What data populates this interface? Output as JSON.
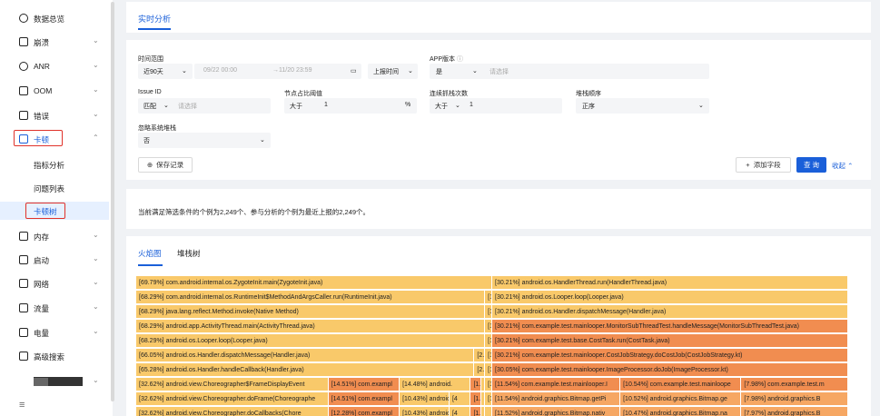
{
  "sidebar": {
    "items": [
      {
        "label": "数据总览",
        "icon": "clock-icon",
        "has_chevron": false
      },
      {
        "label": "崩溃",
        "icon": "crash-icon",
        "has_chevron": true
      },
      {
        "label": "ANR",
        "icon": "anr-icon",
        "has_chevron": true
      },
      {
        "label": "OOM",
        "icon": "oom-icon",
        "has_chevron": true
      },
      {
        "label": "错误",
        "icon": "error-icon",
        "has_chevron": true
      },
      {
        "label": "卡顿",
        "icon": "lag-icon",
        "has_chevron": true,
        "expanded": true
      },
      {
        "label": "内存",
        "icon": "memory-icon",
        "has_chevron": true
      },
      {
        "label": "启动",
        "icon": "startup-icon",
        "has_chevron": true
      },
      {
        "label": "网络",
        "icon": "network-icon",
        "has_chevron": true
      },
      {
        "label": "流量",
        "icon": "traffic-icon",
        "has_chevron": true
      },
      {
        "label": "电量",
        "icon": "battery-icon",
        "has_chevron": true
      },
      {
        "label": "高级搜索",
        "icon": "search-icon",
        "has_chevron": false
      }
    ],
    "sub_items": [
      {
        "label": "指标分析"
      },
      {
        "label": "问题列表"
      },
      {
        "label": "卡顿树",
        "active": true
      }
    ]
  },
  "header": {
    "tab": "实时分析"
  },
  "filters": {
    "time_range": {
      "label": "时间范围",
      "preset": "近90天",
      "start": "09/22 00:00",
      "end": "→11/20 23:59",
      "mode": "上报时间"
    },
    "app_version": {
      "label": "APP版本",
      "op": "是",
      "placeholder": "请选择"
    },
    "issue_id": {
      "label": "Issue ID",
      "op": "匹配",
      "placeholder": "请选择"
    },
    "node_ratio": {
      "label": "节点占比阈值",
      "op": "大于",
      "value": "1",
      "unit": "%"
    },
    "consecutive": {
      "label": "连续抓栈次数",
      "op": "大于",
      "value": "1"
    },
    "stack_order": {
      "label": "堆栈顺序",
      "value": "正序"
    },
    "ignore_system": {
      "label": "忽略系统堆栈",
      "value": "否"
    }
  },
  "actions": {
    "save": "保存记录",
    "add_field": "添加字段",
    "query": "查 询",
    "collapse": "收起"
  },
  "summary": "当前满足筛选条件的个例为2,249个、参与分析的个例为最近上报的2,249个。",
  "flame_tabs": [
    {
      "label": "火焰图",
      "active": true
    },
    {
      "label": "堆栈树",
      "active": false
    }
  ],
  "colors": {
    "accent": "#1a5fd9",
    "flame_light": "#f9c96a",
    "flame_mid": "#f6a763",
    "flame_dark": "#f18d50"
  },
  "flame": {
    "rows": [
      [
        {
          "l": "[69.79%] com.android.internal.os.ZygoteInit.main(ZygoteInit.java)",
          "s": 0,
          "w": 0.5,
          "c": "l"
        },
        {
          "l": "[30.21%] android.os.HandlerThread.run(HandlerThread.java)",
          "s": 0.5,
          "w": 0.5,
          "c": "l"
        }
      ],
      [
        {
          "l": "[68.29%] com.android.internal.os.RuntimeInit$MethodAndArgsCaller.run(RuntimeInit.java)",
          "s": 0,
          "w": 0.49,
          "c": "l"
        },
        {
          "l": "[1",
          "s": 0.49,
          "w": 0.01,
          "c": "l"
        },
        {
          "l": "[30.21%] android.os.Looper.loop(Looper.java)",
          "s": 0.5,
          "w": 0.5,
          "c": "l"
        }
      ],
      [
        {
          "l": "[68.29%] java.lang.reflect.Method.invoke(Native Method)",
          "s": 0,
          "w": 0.49,
          "c": "l"
        },
        {
          "l": "[1",
          "s": 0.49,
          "w": 0.01,
          "c": "l"
        },
        {
          "l": "[30.21%] android.os.Handler.dispatchMessage(Handler.java)",
          "s": 0.5,
          "w": 0.5,
          "c": "l"
        }
      ],
      [
        {
          "l": "[68.29%] android.app.ActivityThread.main(ActivityThread.java)",
          "s": 0,
          "w": 0.49,
          "c": "l"
        },
        {
          "l": "[1",
          "s": 0.49,
          "w": 0.01,
          "c": "l"
        },
        {
          "l": "[30.21%] com.example.test.mainlooper.MonitorSubThreadTest.handleMessage(MonitorSubThreadTest.java)",
          "s": 0.5,
          "w": 0.5,
          "c": "d"
        }
      ],
      [
        {
          "l": "[68.29%] android.os.Looper.loop(Looper.java)",
          "s": 0,
          "w": 0.49,
          "c": "l"
        },
        {
          "l": "[1",
          "s": 0.49,
          "w": 0.01,
          "c": "l"
        },
        {
          "l": "[30.21%] com.example.test.base.CostTask.run(CostTask.java)",
          "s": 0.5,
          "w": 0.5,
          "c": "d"
        }
      ],
      [
        {
          "l": "[66.05%] android.os.Handler.dispatchMessage(Handler.java)",
          "s": 0,
          "w": 0.475,
          "c": "l"
        },
        {
          "l": "[2.",
          "s": 0.475,
          "w": 0.015,
          "c": "l"
        },
        {
          "l": "[1",
          "s": 0.49,
          "w": 0.01,
          "c": "l"
        },
        {
          "l": "[30.21%] com.example.test.mainlooper.CostJobStrategy.doCostJob(CostJobStrategy.kt)",
          "s": 0.5,
          "w": 0.5,
          "c": "d"
        }
      ],
      [
        {
          "l": "[65.28%] android.os.Handler.handleCallback(Handler.java)",
          "s": 0,
          "w": 0.475,
          "c": "l"
        },
        {
          "l": "[2.",
          "s": 0.475,
          "w": 0.015,
          "c": "l"
        },
        {
          "l": "[1",
          "s": 0.49,
          "w": 0.01,
          "c": "l"
        },
        {
          "l": "[30.05%] com.example.test.mainlooper.ImageProcessor.doJob(ImageProcessor.kt)",
          "s": 0.5,
          "w": 0.5,
          "c": "d"
        }
      ],
      [
        {
          "l": "[32.62%] android.view.Choreographer$FrameDisplayEvent",
          "s": 0,
          "w": 0.27,
          "c": "l"
        },
        {
          "l": "[14.51%] com.exampl",
          "s": 0.27,
          "w": 0.1,
          "c": "d"
        },
        {
          "l": "[14.48%] android.",
          "s": 0.37,
          "w": 0.1,
          "c": "l"
        },
        {
          "l": "[1.",
          "s": 0.47,
          "w": 0.015,
          "c": "d"
        },
        {
          "l": "[2.",
          "s": 0.485,
          "w": 0.005,
          "c": "l"
        },
        {
          "l": "[1",
          "s": 0.49,
          "w": 0.01,
          "c": "l"
        },
        {
          "l": "[11.54%] com.example.test.mainlooper.I",
          "s": 0.5,
          "w": 0.18,
          "c": "d"
        },
        {
          "l": "[10.54%] com.example.test.mainloope",
          "s": 0.68,
          "w": 0.17,
          "c": "d"
        },
        {
          "l": "[7.98%] com.example.test.m",
          "s": 0.85,
          "w": 0.15,
          "c": "d"
        }
      ],
      [
        {
          "l": "[32.62%] android.view.Choreographer.doFrame(Choreographe",
          "s": 0,
          "w": 0.27,
          "c": "l"
        },
        {
          "l": "[14.51%] com.exampl",
          "s": 0.27,
          "w": 0.1,
          "c": "d"
        },
        {
          "l": "[10.43%] android",
          "s": 0.37,
          "w": 0.07,
          "c": "l"
        },
        {
          "l": "[4",
          "s": 0.44,
          "w": 0.03,
          "c": "l"
        },
        {
          "l": "[1.",
          "s": 0.47,
          "w": 0.015,
          "c": "d"
        },
        {
          "l": "[2.",
          "s": 0.485,
          "w": 0.005,
          "c": "l"
        },
        {
          "l": "[1",
          "s": 0.49,
          "w": 0.01,
          "c": "l"
        },
        {
          "l": "[11.54%] android.graphics.Bitmap.getPi",
          "s": 0.5,
          "w": 0.18,
          "c": "m"
        },
        {
          "l": "[10.52%] android.graphics.Bitmap.ge",
          "s": 0.68,
          "w": 0.17,
          "c": "m"
        },
        {
          "l": "[7.98%] android.graphics.B",
          "s": 0.85,
          "w": 0.15,
          "c": "m"
        }
      ],
      [
        {
          "l": "[32.62%] android.view.Choreographer.doCallbacks(Chore",
          "s": 0,
          "w": 0.27,
          "c": "l"
        },
        {
          "l": "[12.28%] com.exampl",
          "s": 0.27,
          "w": 0.1,
          "c": "d"
        },
        {
          "l": "[10.43%] android",
          "s": 0.37,
          "w": 0.07,
          "c": "l"
        },
        {
          "l": "[4",
          "s": 0.44,
          "w": 0.03,
          "c": "l"
        },
        {
          "l": "[1.",
          "s": 0.47,
          "w": 0.015,
          "c": "d"
        },
        {
          "l": "[2.",
          "s": 0.485,
          "w": 0.005,
          "c": "l"
        },
        {
          "l": "",
          "s": 0.49,
          "w": 0.01,
          "c": "l"
        },
        {
          "l": "[11.52%] android.graphics.Bitmap.nativ",
          "s": 0.5,
          "w": 0.18,
          "c": "m"
        },
        {
          "l": "[10.47%] android.graphics.Bitmap.na",
          "s": 0.68,
          "w": 0.17,
          "c": "m"
        },
        {
          "l": "[7.97%] android.graphics.B",
          "s": 0.85,
          "w": 0.15,
          "c": "m"
        }
      ]
    ]
  }
}
